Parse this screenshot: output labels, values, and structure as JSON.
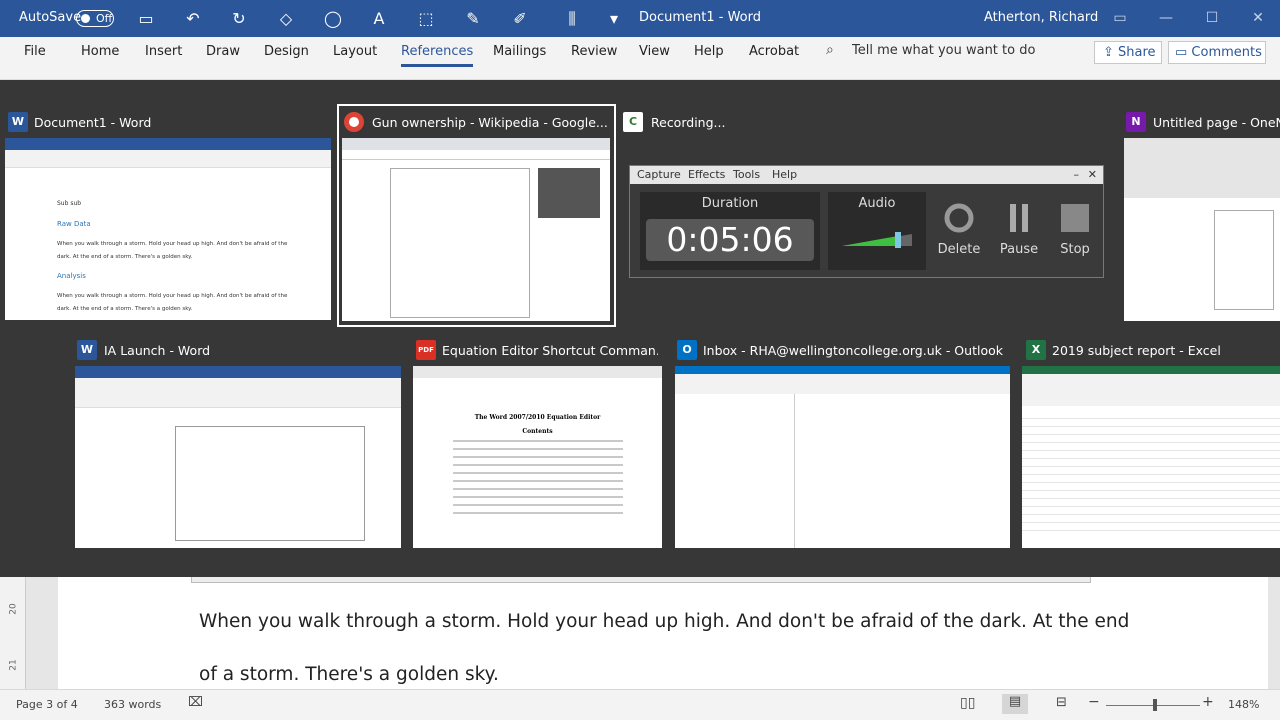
{
  "titlebar": {
    "autosave_label": "AutoSave",
    "autosave_state": "Off",
    "document_title": "Document1 - Word",
    "user": "Atherton, Richard"
  },
  "ribbon_tabs": [
    "File",
    "Home",
    "Insert",
    "Draw",
    "Design",
    "Layout",
    "References",
    "Mailings",
    "Review",
    "View",
    "Help",
    "Acrobat"
  ],
  "active_tab": "References",
  "tell_me": "Tell me what you want to do",
  "share_label": "Share",
  "comments_label": "Comments",
  "windows": {
    "row1": [
      {
        "title": "Document1 - Word",
        "icon": "word-icon",
        "icon_letter": "W",
        "color": "#2b579a"
      },
      {
        "title": "Gun ownership - Wikipedia - Google...",
        "icon": "chrome-icon",
        "icon_letter": "",
        "color": "#db4437"
      },
      {
        "title": "Recording...",
        "icon": "camtasia-icon",
        "icon_letter": "C",
        "color": "#2e7d32"
      },
      {
        "title": "Untitled page - OneNote",
        "icon": "onenote-icon",
        "icon_letter": "N",
        "color": "#7719aa"
      }
    ],
    "row2": [
      {
        "title": "IA Launch - Word",
        "icon": "word-icon",
        "icon_letter": "W",
        "color": "#2b579a"
      },
      {
        "title": "Equation Editor Shortcut Comman...",
        "icon": "pdf-icon",
        "icon_letter": "PDF",
        "color": "#d93025"
      },
      {
        "title": "Inbox - RHA@wellingtoncollege.org.uk - Outlook",
        "icon": "outlook-icon",
        "icon_letter": "O",
        "color": "#0072c6"
      },
      {
        "title": "2019 subject report - Excel",
        "icon": "excel-icon",
        "icon_letter": "X",
        "color": "#217346"
      }
    ]
  },
  "thumbnails": {
    "doc1": {
      "heading1": "Raw Data",
      "heading2": "Analysis",
      "body": "When you walk through a storm. Hold your head up high. And don't be afraid of the dark. At the end of a storm. There's a golden sky."
    },
    "equation": {
      "title": "The Word 2007/2010 Equation Editor",
      "contents": "Contents"
    }
  },
  "recorder": {
    "menu": [
      "Capture",
      "Effects",
      "Tools",
      "Help"
    ],
    "duration_label": "Duration",
    "duration": "0:05:06",
    "audio_label": "Audio",
    "audio_level": 0.8,
    "delete_label": "Delete",
    "pause_label": "Pause",
    "stop_label": "Stop"
  },
  "document": {
    "line1": "When you walk through a storm. Hold your head up high. And don't be afraid of the dark. At the end",
    "line2": "of a storm. There's a golden sky."
  },
  "ruler_marks": [
    "20",
    "21"
  ],
  "status": {
    "page": "Page 3 of 4",
    "words": "363 words",
    "zoom": "148%",
    "zoom_level": 0.52
  }
}
